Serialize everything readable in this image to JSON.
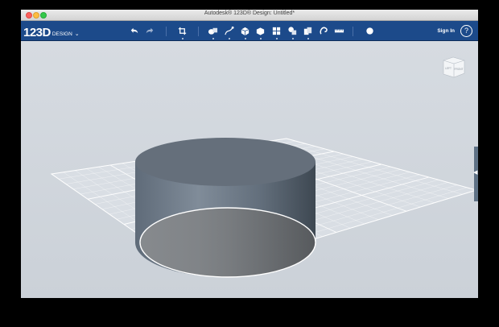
{
  "window": {
    "title": "Autodesk® 123D® Design: Untitled*"
  },
  "toolbar": {
    "logo_main": "123D",
    "logo_sub": "DESIGN",
    "logo_chevron": "⌄",
    "sign_in": "Sign In",
    "help": "?",
    "tools": [
      {
        "name": "undo-icon"
      },
      {
        "name": "redo-icon"
      },
      {
        "name": "transform-icon"
      },
      {
        "name": "primitives-icon"
      },
      {
        "name": "sketch-icon"
      },
      {
        "name": "construct-icon"
      },
      {
        "name": "modify-icon"
      },
      {
        "name": "pattern-icon"
      },
      {
        "name": "grouping-icon"
      },
      {
        "name": "combine-icon"
      },
      {
        "name": "snap-icon"
      },
      {
        "name": "measure-icon"
      },
      {
        "name": "material-icon"
      }
    ]
  },
  "navcube": {
    "front_label": "FRONT",
    "left_label": "LEFT"
  },
  "side_tab": {
    "arrow": "◀"
  },
  "colors": {
    "toolbar_bg": "#1c4a8a",
    "viewport_bg": "#d0d6dd",
    "cylinder": "#6b7886",
    "selection_outline": "#ffffff"
  }
}
